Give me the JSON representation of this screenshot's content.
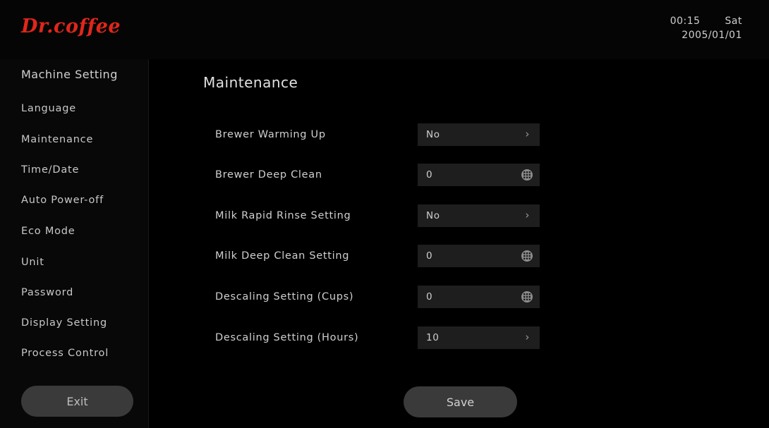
{
  "header": {
    "logo_text": "Dr.coffee",
    "time": "00:15",
    "day": "Sat",
    "date": "2005/01/01"
  },
  "sidebar": {
    "title": "Machine Setting",
    "items": [
      {
        "label": "Language"
      },
      {
        "label": "Maintenance"
      },
      {
        "label": "Time/Date"
      },
      {
        "label": "Auto Power-off"
      },
      {
        "label": "Eco Mode"
      },
      {
        "label": "Unit"
      },
      {
        "label": "Password"
      },
      {
        "label": "Display Setting"
      },
      {
        "label": "Process Control"
      }
    ],
    "exit_label": "Exit"
  },
  "main": {
    "title": "Maintenance",
    "rows": [
      {
        "label": "Brewer Warming Up",
        "value": "No",
        "control": "chevron-right-icon"
      },
      {
        "label": "Brewer Deep Clean",
        "value": "0",
        "control": "keypad-icon"
      },
      {
        "label": "Milk Rapid Rinse Setting",
        "value": "No",
        "control": "chevron-right-icon"
      },
      {
        "label": "Milk Deep Clean Setting",
        "value": "0",
        "control": "keypad-icon"
      },
      {
        "label": "Descaling Setting (Cups)",
        "value": "0",
        "control": "keypad-icon"
      },
      {
        "label": "Descaling Setting (Hours)",
        "value": "10",
        "control": "chevron-right-icon"
      }
    ],
    "save_label": "Save"
  },
  "colors": {
    "background": "#000000",
    "brand": "#e0261b",
    "field": "#1e1e1e",
    "button": "#3a3a3a"
  }
}
